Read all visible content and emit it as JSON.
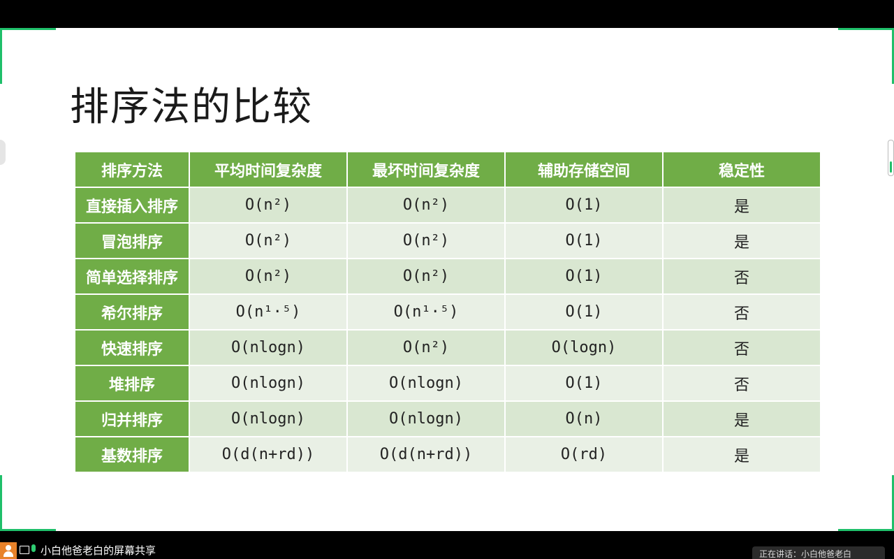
{
  "slide": {
    "title": "排序法的比较",
    "headers": [
      "排序方法",
      "平均时间复杂度",
      "最坏时间复杂度",
      "辅助存储空间",
      "稳定性"
    ],
    "rows": [
      {
        "name": "直接插入排序",
        "avg": "O(n²)",
        "worst": "O(n²)",
        "space": "O(1)",
        "stable": "是"
      },
      {
        "name": "冒泡排序",
        "avg": "O(n²)",
        "worst": "O(n²)",
        "space": "O(1)",
        "stable": "是"
      },
      {
        "name": "简单选择排序",
        "avg": "O(n²)",
        "worst": "O(n²)",
        "space": "O(1)",
        "stable": "否"
      },
      {
        "name": "希尔排序",
        "avg": "O(n¹·⁵)",
        "worst": "O(n¹·⁵)",
        "space": "O(1)",
        "stable": "否"
      },
      {
        "name": "快速排序",
        "avg": "O(nlogn)",
        "worst": "O(n²)",
        "space": "O(logn)",
        "stable": "否"
      },
      {
        "name": "堆排序",
        "avg": "O(nlogn)",
        "worst": "O(nlogn)",
        "space": "O(1)",
        "stable": "否"
      },
      {
        "name": "归并排序",
        "avg": "O(nlogn)",
        "worst": "O(nlogn)",
        "space": "O(n)",
        "stable": "是"
      },
      {
        "name": "基数排序",
        "avg": "O(d(n+rd))",
        "worst": "O(d(n+rd))",
        "space": "O(rd)",
        "stable": "是"
      }
    ]
  },
  "share_bar": {
    "title": "小白他爸老白的屏幕共享",
    "speaking": "正在讲话：小白他爸老白"
  },
  "icons": {
    "avatar": "user-avatar-icon",
    "screen": "screen-share-icon",
    "mic": "microphone-icon"
  },
  "colors": {
    "header_green": "#70ad47",
    "row_odd": "#d9e7d1",
    "row_even": "#e9f0e5",
    "frame_green": "#1fbf6a"
  }
}
